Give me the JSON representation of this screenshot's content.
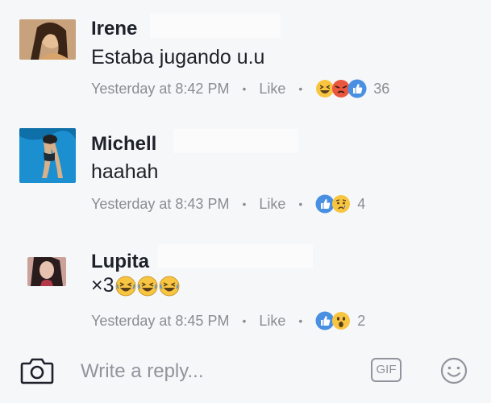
{
  "comments": [
    {
      "name": "Irene",
      "text": "Estaba jugando u.u",
      "time": "Yesterday at 8:42 PM",
      "like_label": "Like",
      "reactions": [
        "haha",
        "angry",
        "like"
      ],
      "reaction_count": "36"
    },
    {
      "name": "Michell",
      "text": "haahah",
      "time": "Yesterday at 8:43 PM",
      "like_label": "Like",
      "reactions": [
        "like",
        "sad"
      ],
      "reaction_count": "4"
    },
    {
      "name": "Lupita",
      "text": "×3",
      "text_emoji": [
        "laughing",
        "laughing",
        "laughing"
      ],
      "time": "Yesterday at 8:45 PM",
      "like_label": "Like",
      "reactions": [
        "like",
        "wow"
      ],
      "reaction_count": "2"
    }
  ],
  "reply": {
    "placeholder": "Write a reply...",
    "gif_label": "GIF",
    "camera_icon": "camera-icon",
    "emoji_icon": "smiley-icon"
  },
  "colors": {
    "like_blue": "#4a90e2",
    "reaction_yellow": "#f7c541",
    "angry_red": "#e9573f",
    "meta_gray": "#8a8d91"
  }
}
